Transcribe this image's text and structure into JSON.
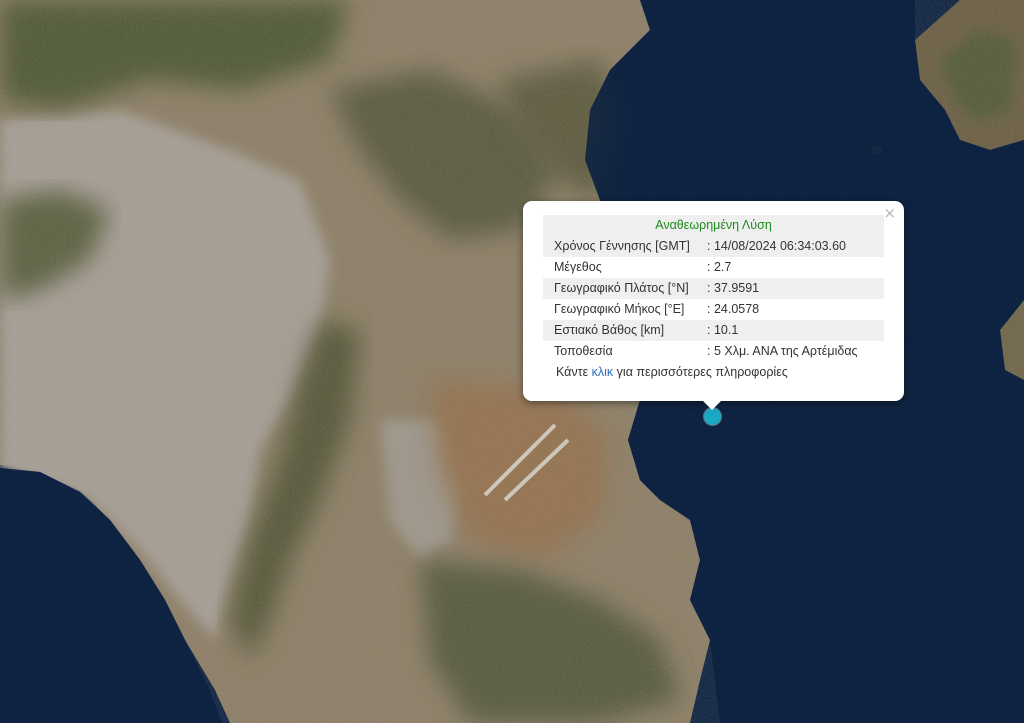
{
  "map": {
    "colors": {
      "sea": "#0d2240",
      "land": "#8d7d63",
      "urban": "#a8a097",
      "mountain": "#4f5a38"
    }
  },
  "popup": {
    "title": "Αναθεωρημένη Λύση",
    "close_symbol": "×",
    "rows": [
      {
        "label": "Χρόνος Γέννησης [GMT]",
        "value": ": 14/08/2024 06:34:03.60"
      },
      {
        "label": "Μέγεθος",
        "value": ": 2.7"
      },
      {
        "label": "Γεωγραφικό Πλάτος [°N]",
        "value": ": 37.9591"
      },
      {
        "label": "Γεωγραφικό Μήκος [°E]",
        "value": ": 24.0578"
      },
      {
        "label": "Εστιακό Βάθος [km]",
        "value": ": 10.1"
      },
      {
        "label": "Τοποθεσία",
        "value": ": 5 Χλμ. ΑΝΑ της Αρτέμιδας"
      }
    ],
    "footer_prefix": "Κάντε ",
    "footer_link": "κλικ",
    "footer_suffix": " για περισσότερες πληροφορίες"
  },
  "marker": {
    "color": "#1aa9c4",
    "icon": "earthquake-marker"
  }
}
